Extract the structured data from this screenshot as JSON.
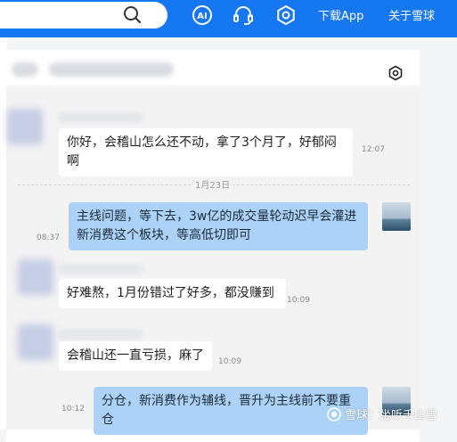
{
  "nav": {
    "download_label": "下载App",
    "about_label": "关于雪球",
    "icons": [
      "search-icon",
      "ai-icon",
      "headset-icon",
      "settings-icon"
    ]
  },
  "chat": {
    "messages": [
      {
        "side": "in",
        "text": "你好，会稽山怎么还不动，拿了3个月了，好郁闷啊",
        "time": "12:07"
      },
      {
        "side": "out",
        "text": "主线问题，等下去，3w亿的成交量轮动迟早会灌进新消费这个板块，等高低切即可",
        "time": "08:37"
      },
      {
        "side": "in",
        "text": "好难熬，1月份错过了好多，都没赚到",
        "time": "10:09"
      },
      {
        "side": "in",
        "text": "会稽山还一直亏损，麻了",
        "time": "10:09"
      },
      {
        "side": "out",
        "text": "分仓，新消费作为辅线，晋升为主线前不要重仓",
        "time": "10:12"
      }
    ],
    "date_divider": "1月23日"
  },
  "watermark": {
    "text": "雪球：坐听千山雪"
  },
  "colors": {
    "brand": "#1677f2",
    "outgoing_bubble": "#acd3f7",
    "incoming_bubble": "#ffffff"
  }
}
